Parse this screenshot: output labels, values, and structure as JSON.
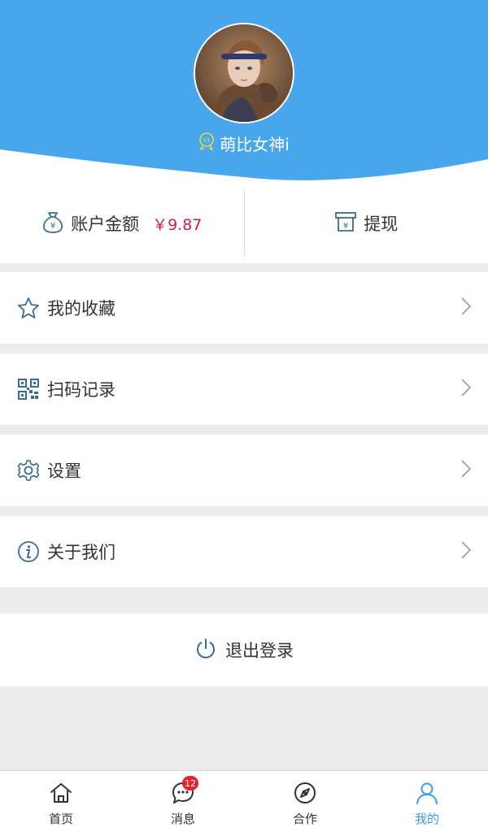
{
  "profile": {
    "username": "萌比女神i",
    "vip_badge": "V1",
    "colors": {
      "header": "#48a6ec",
      "accent": "#3a9de8"
    }
  },
  "account": {
    "balance_label": "账户金额",
    "balance_value": "￥9.87",
    "withdraw_label": "提现",
    "colors": {
      "amount": "#d6195a"
    }
  },
  "menu": {
    "favorites": "我的收藏",
    "scan_history": "扫码记录",
    "settings": "设置",
    "about": "关于我们"
  },
  "logout_label": "退出登录",
  "tabbar": {
    "home": "首页",
    "messages": "消息",
    "messages_badge": "12",
    "cooperation": "合作",
    "mine": "我的"
  },
  "icons": {
    "balance": "money-bag-icon",
    "withdraw": "withdraw-icon",
    "favorites": "star-icon",
    "scan": "qr-code-icon",
    "settings": "gear-icon",
    "about": "info-icon",
    "logout": "power-icon",
    "home": "home-icon",
    "messages": "chat-icon",
    "cooperation": "compass-icon",
    "mine": "user-icon",
    "chevron": "chevron-right-icon"
  }
}
